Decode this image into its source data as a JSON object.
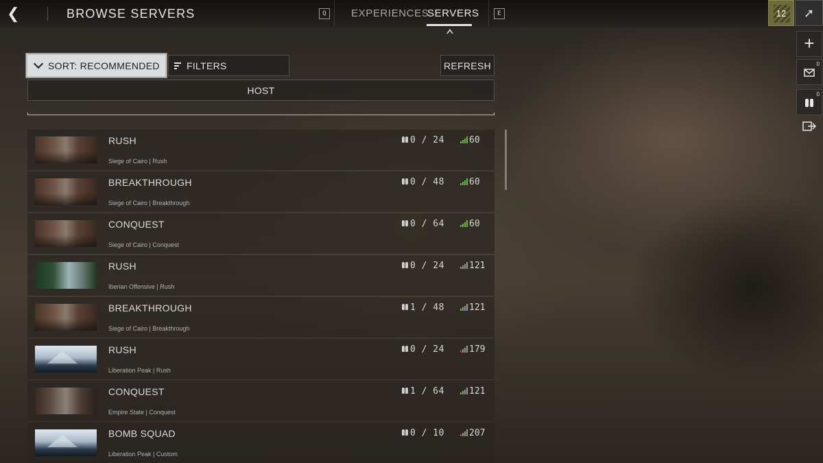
{
  "header": {
    "title": "BROWSE SERVERS",
    "key_prev": "Q",
    "key_next": "E",
    "tabs": [
      {
        "label": "EXPERIENCES",
        "active": false
      },
      {
        "label": "SERVERS",
        "active": true
      }
    ]
  },
  "rail": {
    "rank": "12",
    "mail_count": "0",
    "squad_count": "0"
  },
  "controls": {
    "sort_label": "SORT: RECOMMENDED",
    "filters_label": "FILTERS",
    "refresh_label": "REFRESH",
    "host_label": "HOST"
  },
  "servers": [
    {
      "mode": "RUSH",
      "map_info": "Siege of Cairo | Rush",
      "players": "0 / 24",
      "ping": "60",
      "thumb": "cairo",
      "ping_quality": "good"
    },
    {
      "mode": "BREAKTHROUGH",
      "map_info": "Siege of Cairo | Breakthrough",
      "players": "0 / 48",
      "ping": "60",
      "thumb": "cairo",
      "ping_quality": "good"
    },
    {
      "mode": "CONQUEST",
      "map_info": "Siege of Cairo | Conquest",
      "players": "0 / 64",
      "ping": "60",
      "thumb": "cairo",
      "ping_quality": "good"
    },
    {
      "mode": "RUSH",
      "map_info": "Iberian Offensive | Rush",
      "players": "0 / 24",
      "ping": "121",
      "thumb": "iberian",
      "ping_quality": "mid"
    },
    {
      "mode": "BREAKTHROUGH",
      "map_info": "Siege of Cairo | Breakthrough",
      "players": "1 / 48",
      "ping": "121",
      "thumb": "cairo",
      "ping_quality": "mid"
    },
    {
      "mode": "RUSH",
      "map_info": "Liberation Peak | Rush",
      "players": "0 / 24",
      "ping": "179",
      "thumb": "liberation",
      "ping_quality": "bad"
    },
    {
      "mode": "CONQUEST",
      "map_info": "Empire State | Conquest",
      "players": "1 / 64",
      "ping": "121",
      "thumb": "empire",
      "ping_quality": "mid"
    },
    {
      "mode": "BOMB SQUAD",
      "map_info": "Liberation Peak | Custom",
      "players": "0 / 10",
      "ping": "207",
      "thumb": "liberation",
      "ping_quality": "bad"
    }
  ],
  "colors": {
    "ping_good": "#6dbb4a",
    "ping_bad": "#c94a3a",
    "sort_button_bg": "#d9dde0"
  }
}
